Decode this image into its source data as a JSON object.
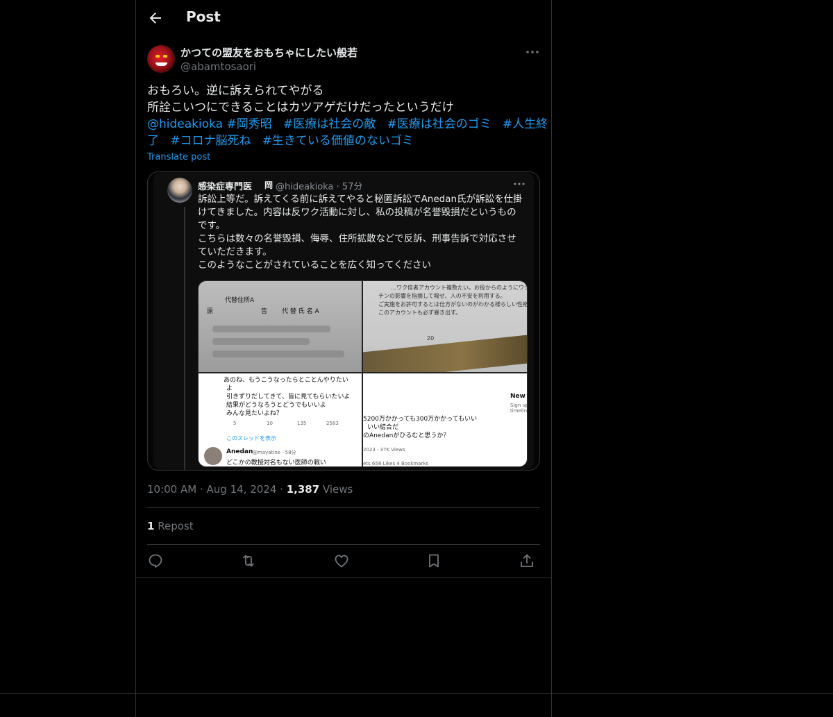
{
  "header": {
    "title": "Post"
  },
  "post": {
    "author_name": "かつての盟友をおもちゃにしたい般若",
    "author_handle": "@abamtosaori",
    "text_line1": "おもろい。逆に訴えられてやがる",
    "text_line2": "所詮こいつにできることはカツアゲだけだったというだけ",
    "mention": "@hideakioka",
    "hashtags": [
      "#岡秀昭",
      "#医療は社会の敵",
      "#医療は社会のゴミ",
      "#人生終",
      "了",
      "#コロナ脳死ね",
      "#生きている価値のないゴミ"
    ],
    "translate_label": "Translate post",
    "time": "10:00 AM",
    "date": "Aug 14, 2024",
    "views_count": "1,387",
    "views_label": "Views",
    "repost_count": "1",
    "repost_label": "Repost"
  },
  "quoted": {
    "name": "感染症専門医",
    "badge": "岡",
    "handle_meta": "@hideakioka · 57分",
    "lines": [
      "訴訟上等だ。訴えてくる前に訴えてやると秘匿訴訟でAnedan氏が訴訟を仕掛",
      "けてきました。内容は反ワク活動に対し、私の投稿が名誉毀損だというもの",
      "です。",
      "こちらは数々の名誉毀損、侮辱、住所拡散などで反訴、刑事告訴で対応させ",
      "ていただきます。",
      "このようなことがされていることを広く知ってください"
    ],
    "media": {
      "tile1": {
        "line1": "代替住所A",
        "line2a": "原",
        "line2b": "告",
        "line2c": "代 替 氏 名 A"
      },
      "tile2": {
        "line1": "…ワク信者アカウント複数たい。お役からのようにワク",
        "line2": "チンの影響を指摘して報せ、人の不安を利用する。",
        "line3": "ご実施をお許可するとは仕方がないのがわかる様らしい性格。",
        "line4": "このアカウントも必ず暴き出す。",
        "page": "20"
      },
      "tile3": {
        "l1": "あのね、もうこうなったらとことんやりたい",
        "l2": "よ",
        "l3": "引きずりだしてきて、皆に見てもらいたいよ",
        "l4": "結果がどうなろうとどうでもいいよ",
        "l5": "みんな見たいよね？",
        "stats": [
          "5",
          "10",
          "135",
          "2583"
        ],
        "thread_link": "このスレッドを表示",
        "reply_name": "Anedan",
        "reply_meta": "@mayatine · 58分",
        "reply_text": "どこかの教授対名もない医師の戦い"
      },
      "tile4": {
        "l1": "5200万かかっても300万かかってもいい",
        "l2": "いい結合だ",
        "l3": "のAnedanがひるむと思うか？",
        "meta": "2023 · 37K Views",
        "stats": "ets   658 Likes   4 Bookmarks",
        "side_title": "New t",
        "side_sub1": "Sign up no",
        "side_sub2": "timeline!"
      }
    }
  },
  "icons": {
    "back": "arrow-left-icon",
    "more": "more-horizontal-icon",
    "reply": "reply-icon",
    "retweet": "retweet-icon",
    "like": "heart-icon",
    "bookmark": "bookmark-icon",
    "share": "share-icon"
  },
  "colors": {
    "background": "#000000",
    "text_primary": "#e7e9ea",
    "text_secondary": "#71767b",
    "link": "#1d9bf0",
    "border": "#2f3336"
  }
}
